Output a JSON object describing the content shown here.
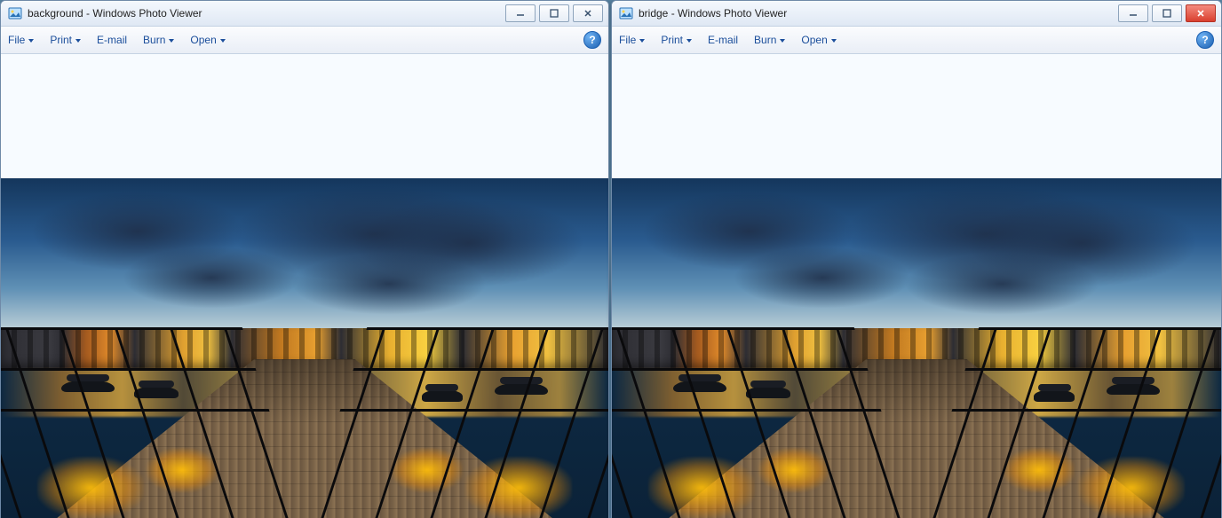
{
  "windows": [
    {
      "id": "left",
      "title": "background - Windows Photo Viewer",
      "active_close": false
    },
    {
      "id": "right",
      "title": "bridge - Windows Photo Viewer",
      "active_close": true
    }
  ],
  "menu": {
    "file": "File",
    "print": "Print",
    "email": "E-mail",
    "burn": "Burn",
    "open": "Open"
  },
  "help_glyph": "?"
}
